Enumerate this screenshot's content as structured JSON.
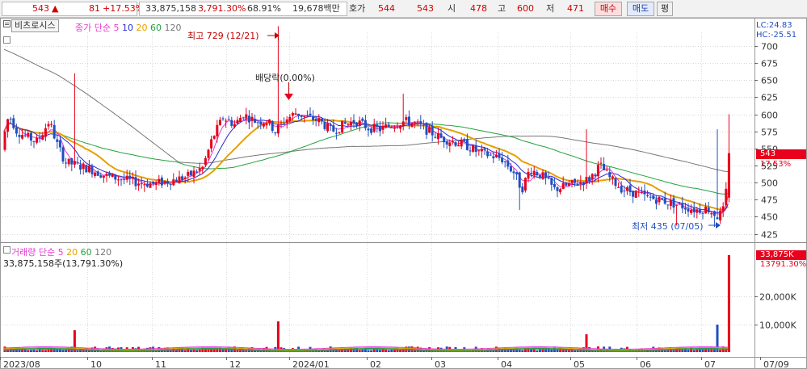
{
  "quote_bar": {
    "price": "543",
    "arrow": "▲",
    "change": "81",
    "change_pct": "+17.53%",
    "volume": "33,875,158",
    "volume_ratio": "3,791.30%",
    "turnover": "68.91%",
    "amount": "19,678백만",
    "hoga_label": "호가",
    "ask": "544",
    "bid": "543",
    "open_label": "시",
    "open": "478",
    "high_label": "고",
    "high": "600",
    "low_label": "저",
    "low": "471",
    "buy_label": "매수",
    "sell_label": "매도",
    "eval_label": "평"
  },
  "price_panel": {
    "title_button": "비츠로시스",
    "legend_prefix": "종가 단순",
    "ma_labels": [
      "5",
      "10",
      "20",
      "60",
      "120"
    ],
    "lc_label": "LC:24.83",
    "hc_label": "HC:-25.51",
    "high_annotation": "최고 729 (12/21)",
    "low_annotation": "최저 435 (07/05)",
    "dividend_annotation": "배당락(0.00%)",
    "current_price_tag": "543",
    "current_change_tag": "17.53%",
    "y_ticks": [
      "700",
      "675",
      "650",
      "625",
      "600",
      "575",
      "550",
      "525",
      "500",
      "475",
      "450",
      "425"
    ]
  },
  "volume_panel": {
    "legend_prefix": "거래량 단순",
    "ma_labels": [
      "5",
      "20",
      "60",
      "120"
    ],
    "summary": "33,875,158주(13,791.30%)",
    "current_vol_tag": "33,875K",
    "current_pct_tag": "13791.30%",
    "y_ticks": [
      "20,000K",
      "10,000K"
    ]
  },
  "x_axis": {
    "labels": [
      "2023/08",
      "10",
      "11",
      "12",
      "2024/01",
      "02",
      "03",
      "04",
      "05",
      "06",
      "07",
      "07/09"
    ]
  },
  "colors": {
    "up": "#e8001c",
    "down": "#1f4fc0",
    "ma5": "#e83ad3",
    "ma10": "#2a2ad0",
    "ma20": "#e6a000",
    "ma60": "#23a23c",
    "ma120": "#777777"
  },
  "chart_data": {
    "type": "candlestick",
    "y_range": [
      415,
      720
    ],
    "key_points": [
      {
        "label": "최고",
        "date": "12/21",
        "value": 729
      },
      {
        "label": "최저",
        "date": "07/05",
        "value": 435
      },
      {
        "label": "current",
        "date": "07/09",
        "open": 478,
        "high": 600,
        "low": 471,
        "close": 543
      }
    ]
  }
}
